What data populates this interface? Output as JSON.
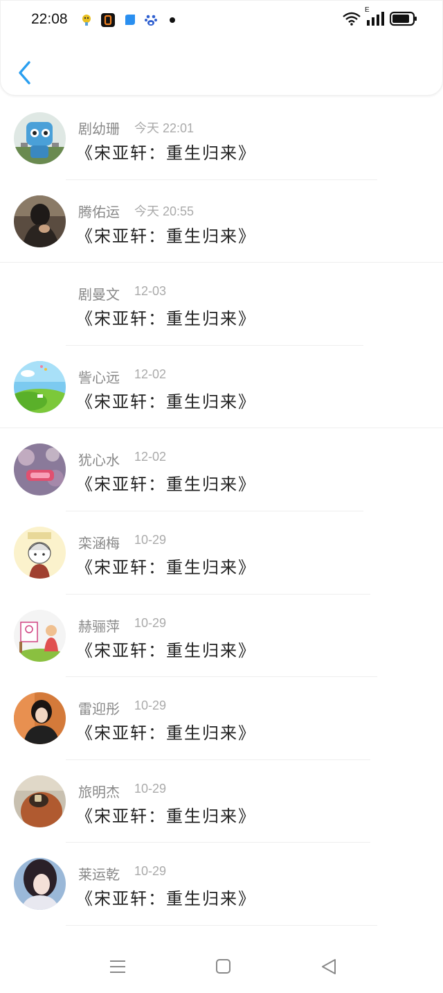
{
  "status_bar": {
    "time": "22:08",
    "icons": [
      "trophy-app-icon",
      "o-app-icon",
      "blue-app-icon",
      "baidu-paw-icon",
      "notification-dot"
    ],
    "right_icons": [
      "wifi-icon",
      "signal-icon",
      "battery-icon"
    ],
    "network_label": "E"
  },
  "header": {
    "back_icon": "chevron-left-icon",
    "accent": "#2a9ff0"
  },
  "items": [
    {
      "name": "剧幼珊",
      "date": "今天 22:01",
      "title": "《宋亚轩：重生归来》",
      "avatar": "robot"
    },
    {
      "name": "腾佑运",
      "date": "今天 20:55",
      "title": "《宋亚轩：重生归来》",
      "avatar": "dark-portrait"
    },
    {
      "name": "剧曼文",
      "date": "12-03",
      "title": "《宋亚轩：重生归来》",
      "avatar": "none"
    },
    {
      "name": "訾心远",
      "date": "12-02",
      "title": "《宋亚轩：重生归来》",
      "avatar": "landscape"
    },
    {
      "name": "犹心水",
      "date": "12-02",
      "title": "《宋亚轩：重生归来》",
      "avatar": "love-bokeh"
    },
    {
      "name": "栾涵梅",
      "date": "10-29",
      "title": "《宋亚轩：重生归来》",
      "avatar": "cartoon-boy"
    },
    {
      "name": "赫骊萍",
      "date": "10-29",
      "title": "《宋亚轩：重生归来》",
      "avatar": "painting-kid"
    },
    {
      "name": "雷迎彤",
      "date": "10-29",
      "title": "《宋亚轩：重生归来》",
      "avatar": "girl-orange"
    },
    {
      "name": "旅明杰",
      "date": "10-29",
      "title": "《宋亚轩：重生归来》",
      "avatar": "hair-clip"
    },
    {
      "name": "莱运乾",
      "date": "10-29",
      "title": "《宋亚轩：重生归来》",
      "avatar": "girl-portrait"
    }
  ],
  "nav": {
    "icons": [
      "menu-icon",
      "home-square-icon",
      "back-triangle-icon"
    ]
  }
}
